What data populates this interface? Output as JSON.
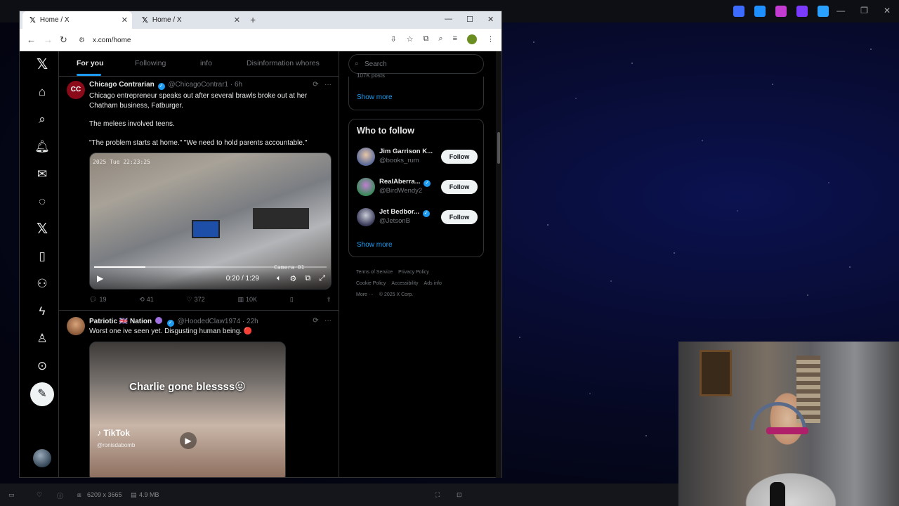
{
  "browser": {
    "tabs": [
      {
        "title": "Home / X",
        "active": true
      },
      {
        "title": "Home / X",
        "active": false
      }
    ],
    "url": "x.com/home"
  },
  "feed": {
    "tabs": [
      "For you",
      "Following",
      "info",
      "Disinformation whores"
    ],
    "posts": [
      {
        "name": "Chicago Contrarian",
        "handle": "@ChicagoContrar1",
        "time": "· 6h",
        "avatar_text": "CC",
        "text_lines": [
          "Chicago entrepreneur speaks out after several brawls broke out at her",
          "Chatham business, Fatburger.",
          "",
          "The melees involved teens.",
          "",
          "\"The problem starts at home.\" \"We need to hold parents accountable.\""
        ],
        "video": {
          "timestamp_overlay": "2025 Tue 22:23:25",
          "camera_label": "Camera 01",
          "time": "0:20 / 1:29",
          "progress": 0.22
        },
        "stats": {
          "replies": "19",
          "reposts": "41",
          "likes": "372",
          "views": "10K"
        }
      },
      {
        "name": "Patriotic 🇬🇧 Nation",
        "handle": "@HoodedClaw1974",
        "time": "· 22h",
        "text": "Worst one ive seen yet. Disgusting human being. 🔴",
        "video": {
          "caption": "Charlie gone blessss😝",
          "tiktok_label": "TikTok",
          "tiktok_user": "@ronisdabomb"
        }
      }
    ]
  },
  "right": {
    "search_placeholder": "Search",
    "trend_posts": "107K posts",
    "show_more": "Show more",
    "who_to_follow": {
      "title": "Who to follow",
      "accounts": [
        {
          "name": "Jim Garrison K...",
          "handle": "@books_rum",
          "verified": false
        },
        {
          "name": "RealAberra...",
          "handle": "@BirdWendy2",
          "verified": true
        },
        {
          "name": "Jet Bedbor...",
          "handle": "@JetsonB",
          "verified": true
        }
      ],
      "follow_label": "Follow",
      "show_more": "Show more"
    },
    "footer": [
      "Terms of Service",
      "Privacy Policy",
      "Cookie Policy",
      "Accessibility",
      "Ads info",
      "More ···",
      "© 2025 X Corp."
    ]
  },
  "statusbar": {
    "dimensions": "6209 x 3665",
    "size": "4.9 MB"
  }
}
